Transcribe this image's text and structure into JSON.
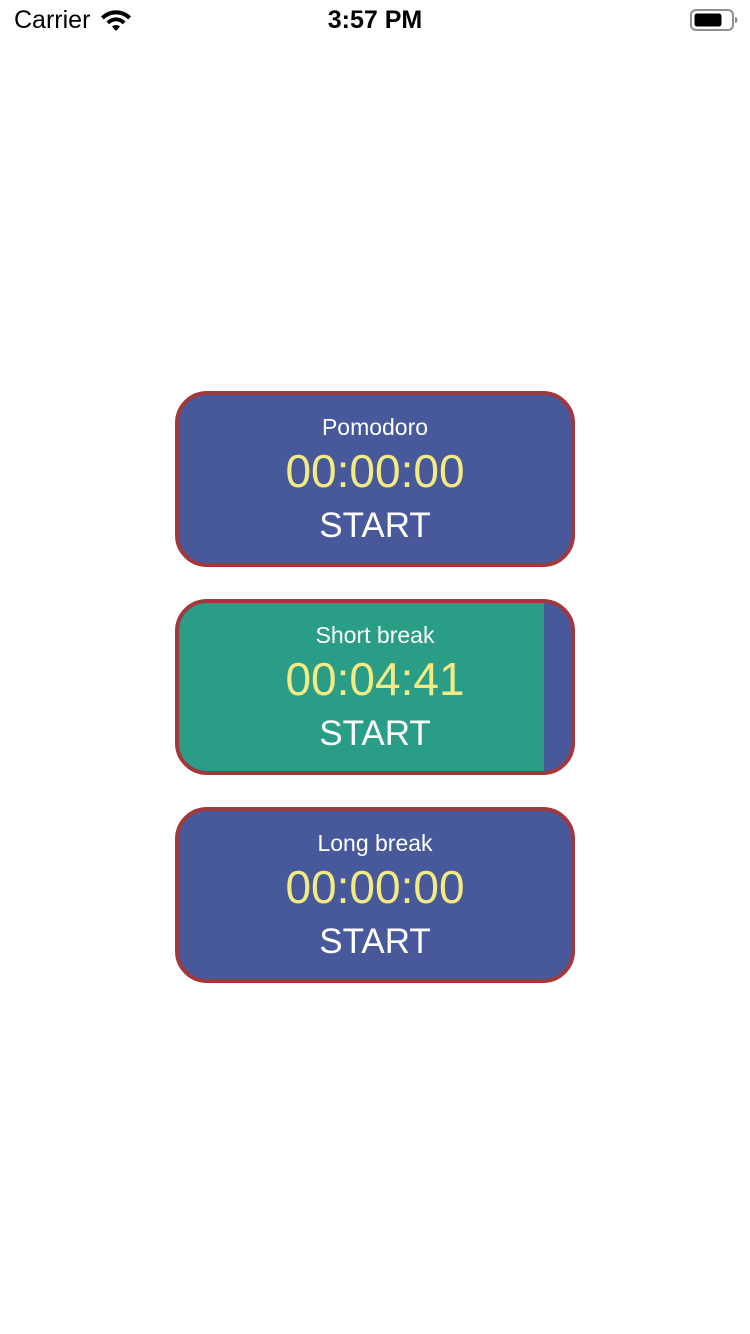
{
  "status_bar": {
    "carrier": "Carrier",
    "time": "3:57 PM",
    "wifi_icon": "wifi-icon",
    "battery_icon": "battery-icon"
  },
  "colors": {
    "card_background": "#48599b",
    "card_border": "#a0383c",
    "progress_fill": "#2a9d87",
    "time_text": "#f3ea84",
    "label_text": "#ffffff"
  },
  "timers": [
    {
      "label": "Pomodoro",
      "time": "00:00:00",
      "action": "START",
      "progress_percent": 0
    },
    {
      "label": "Short break",
      "time": "00:04:41",
      "action": "START",
      "progress_percent": 93
    },
    {
      "label": "Long break",
      "time": "00:00:00",
      "action": "START",
      "progress_percent": 0
    }
  ]
}
